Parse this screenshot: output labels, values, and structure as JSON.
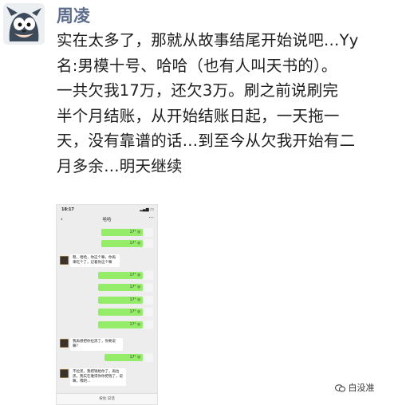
{
  "post": {
    "author": "周凌",
    "lines": [
      "实在太多了，那就从故事结尾开始说吧…Yy",
      "名:男模十号、哈哈（也有人叫天书的）。",
      "一共欠我17万，还欠3万。刷之前说刷完",
      "半个月结账，从开始结账日起，一天拖一",
      "天，没有靠谱的话…到至今从欠我开始有二",
      "月多余…明天继续"
    ]
  },
  "screenshot": {
    "status_time": "18:17",
    "nav_back": "‹",
    "nav_title": "哈哈",
    "nav_more": "···",
    "out_messages": [
      "17° ◎",
      "17° ◎",
      "17° ◎",
      "17° ◎",
      "17° ◎",
      "17° ◎",
      "17° ◎",
      "17° ◎"
    ],
    "in_messages": [
      "嗯，哈哈，你这个嘛，你再来吃个了，记着你这个嘛",
      "我再想把你拉黑了，你要说嘛？",
      "不拉黑，我把钱给你了，再拉黑，我实在难得你你把钱了，说嘛，嘿吧…"
    ],
    "input_label": "按住 说话"
  },
  "watermark": "白没准"
}
